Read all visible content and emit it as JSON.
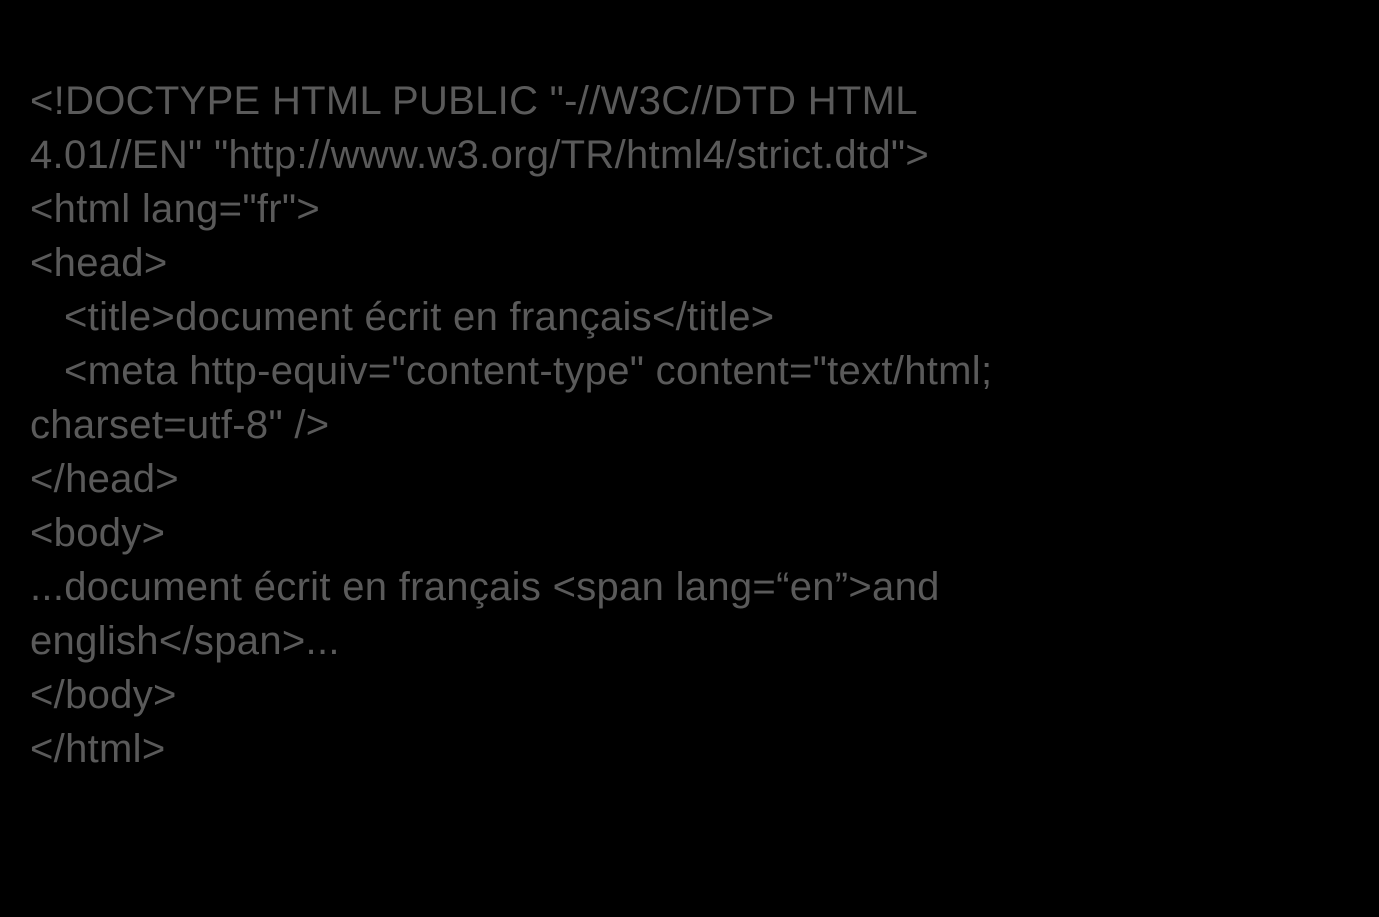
{
  "code": {
    "l1a": "<!DOCTYPE HTML PUBLIC \"-//W3C//DTD HTML",
    "l1b": "4.01//EN\" \"http://www.w3.org/TR/html4/strict.dtd\">",
    "l2": "<html lang=\"fr\">",
    "l3": "<head>",
    "l4": "<title>document écrit en français</title>",
    "l5a": "<meta http-equiv=\"content-type\" content=\"text/html;",
    "l5b": "charset=utf-8\" />",
    "l6": "</head>",
    "l7": "<body>",
    "l8a": "...document écrit en français <span lang=“en”>and",
    "l8b": "english</span>...",
    "l9": "</body>",
    "l10": "</html>"
  }
}
